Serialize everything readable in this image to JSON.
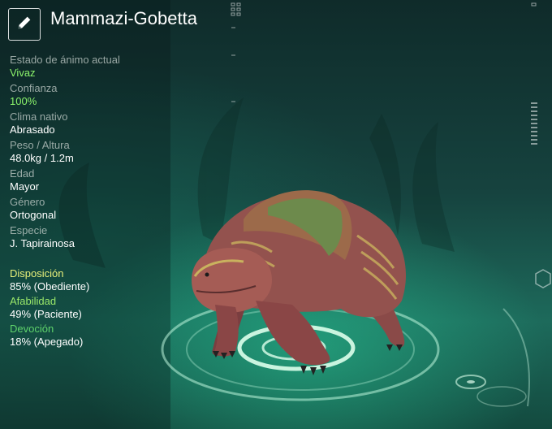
{
  "creature": {
    "name": "Mammazi-Gobetta",
    "edit_icon": "pencil-icon"
  },
  "stats": [
    {
      "label": "Estado de ánimo actual",
      "value": "Vivaz",
      "highlight": true
    },
    {
      "label": "Confianza",
      "value": "100%",
      "highlight": true
    },
    {
      "label": "Clima nativo",
      "value": "Abrasado",
      "highlight": false
    },
    {
      "label": "Peso / Altura",
      "value": "48.0kg / 1.2m",
      "highlight": false
    },
    {
      "label": "Edad",
      "value": "Mayor",
      "highlight": false
    },
    {
      "label": "Género",
      "value": "Ortogonal",
      "highlight": false
    },
    {
      "label": "Especie",
      "value": "J. Tapirainosa",
      "highlight": false
    }
  ],
  "traits": [
    {
      "label": "Disposición",
      "value": "85% (Obediente)",
      "color": "#e8f07a"
    },
    {
      "label": "Afabilidad",
      "value": "49% (Paciente)",
      "color": "#9be86a"
    },
    {
      "label": "Devoción",
      "value": "18% (Apegado)",
      "color": "#5fd36b"
    }
  ],
  "colors": {
    "accent_green": "#8cf56c",
    "ring": "#bff5dc"
  }
}
